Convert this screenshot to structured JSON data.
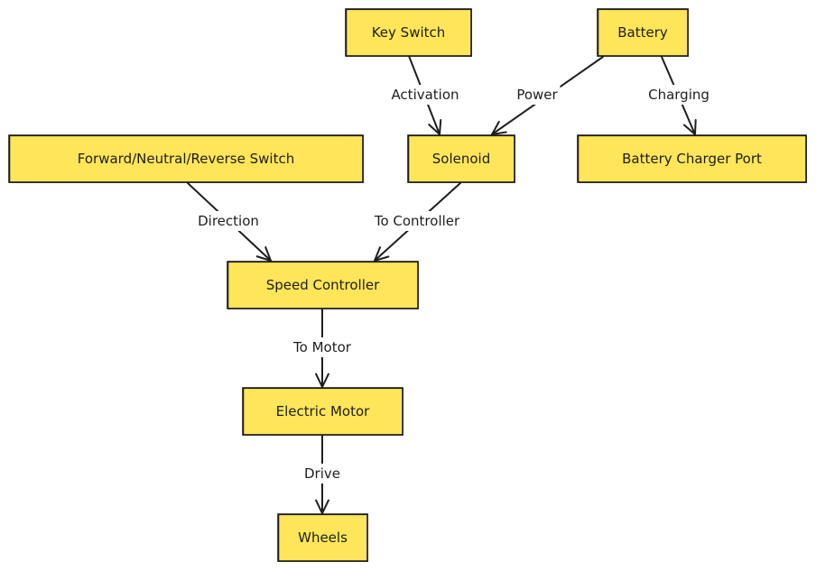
{
  "diagram": {
    "colors": {
      "node_fill": "#ffe55a",
      "stroke": "#1e1e1e",
      "background": "#ffffff"
    },
    "nodes": [
      {
        "id": "key",
        "label": "Key Switch"
      },
      {
        "id": "battery",
        "label": "Battery"
      },
      {
        "id": "fnr",
        "label": "Forward/Neutral/Reverse Switch"
      },
      {
        "id": "solenoid",
        "label": "Solenoid"
      },
      {
        "id": "charger",
        "label": "Battery Charger Port"
      },
      {
        "id": "speed",
        "label": "Speed Controller"
      },
      {
        "id": "motor",
        "label": "Electric Motor"
      },
      {
        "id": "wheels",
        "label": "Wheels"
      }
    ],
    "edges": [
      {
        "from": "key",
        "to": "solenoid",
        "label": "Activation"
      },
      {
        "from": "battery",
        "to": "solenoid",
        "label": "Power"
      },
      {
        "from": "battery",
        "to": "charger",
        "label": "Charging"
      },
      {
        "from": "fnr",
        "to": "speed",
        "label": "Direction"
      },
      {
        "from": "solenoid",
        "to": "speed",
        "label": "To Controller"
      },
      {
        "from": "speed",
        "to": "motor",
        "label": "To Motor"
      },
      {
        "from": "motor",
        "to": "wheels",
        "label": "Drive"
      }
    ]
  }
}
